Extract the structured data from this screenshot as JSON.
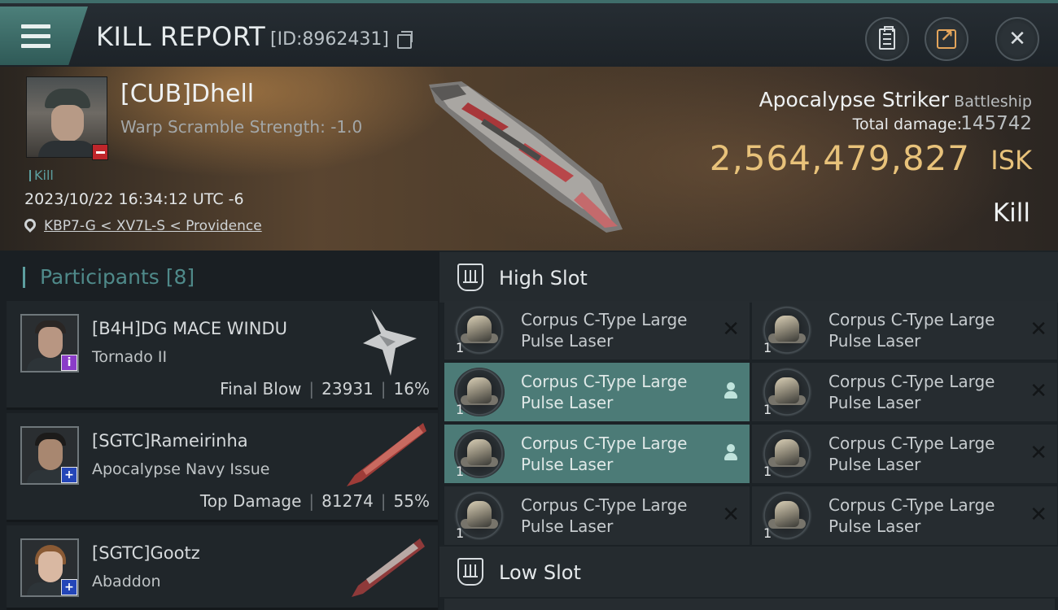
{
  "header": {
    "title": "KILL REPORT",
    "report_id": "[ID:8962431]",
    "icons": [
      "menu-icon",
      "copy-icon",
      "clipboard-icon",
      "share-icon",
      "close-icon"
    ]
  },
  "victim": {
    "name": "[CUB]Dhell",
    "warp_scramble": "Warp Scramble Strength: -1.0",
    "tag": "Kill",
    "datetime": "2023/10/22 16:34:12 UTC -6",
    "location": "KBP7-G < XV7L-S < Providence",
    "ship_name": "Apocalypse Striker",
    "ship_class": "Battleship",
    "total_damage_label": "Total damage:",
    "total_damage": "145742",
    "isk_value": "2,564,479,827",
    "isk_unit": "ISK",
    "result": "Kill"
  },
  "participants": {
    "title": "Participants",
    "count": "[8]",
    "items": [
      {
        "name": "[B4H]DG MACE WINDU",
        "ship": "Tornado II",
        "role": "Final Blow",
        "damage": "23931",
        "percent": "16%",
        "badge": "i",
        "badge_color": "#8a3cc8"
      },
      {
        "name": "[SGTC]Rameirinha",
        "ship": "Apocalypse Navy Issue",
        "role": "Top Damage",
        "damage": "81274",
        "percent": "55%",
        "badge": "+",
        "badge_color": "#2446b8"
      },
      {
        "name": "[SGTC]Gootz",
        "ship": "Abaddon",
        "role": "",
        "damage": "",
        "percent": "",
        "badge": "+",
        "badge_color": "#2446b8"
      }
    ]
  },
  "fitting": {
    "high_slot_title": "High Slot",
    "low_slot_title": "Low Slot",
    "high_slot": [
      {
        "line1": "Corpus C-Type Large",
        "line2": "Pulse Laser",
        "qty": "1",
        "state": "destroyed"
      },
      {
        "line1": "Corpus C-Type Large",
        "line2": "Pulse Laser",
        "qty": "1",
        "state": "destroyed"
      },
      {
        "line1": "Corpus C-Type Large",
        "line2": "Pulse Laser",
        "qty": "1",
        "state": "dropped"
      },
      {
        "line1": "Corpus C-Type Large",
        "line2": "Pulse Laser",
        "qty": "1",
        "state": "destroyed"
      },
      {
        "line1": "Corpus C-Type Large",
        "line2": "Pulse Laser",
        "qty": "1",
        "state": "dropped"
      },
      {
        "line1": "Corpus C-Type Large",
        "line2": "Pulse Laser",
        "qty": "1",
        "state": "destroyed"
      },
      {
        "line1": "Corpus C-Type Large",
        "line2": "Pulse Laser",
        "qty": "1",
        "state": "destroyed"
      },
      {
        "line1": "Corpus C-Type Large",
        "line2": "Pulse Laser",
        "qty": "1",
        "state": "destroyed"
      }
    ]
  },
  "colors": {
    "accent": "#4c7b77",
    "isk": "#e8c27a",
    "loss_badge": "#c0262b"
  }
}
